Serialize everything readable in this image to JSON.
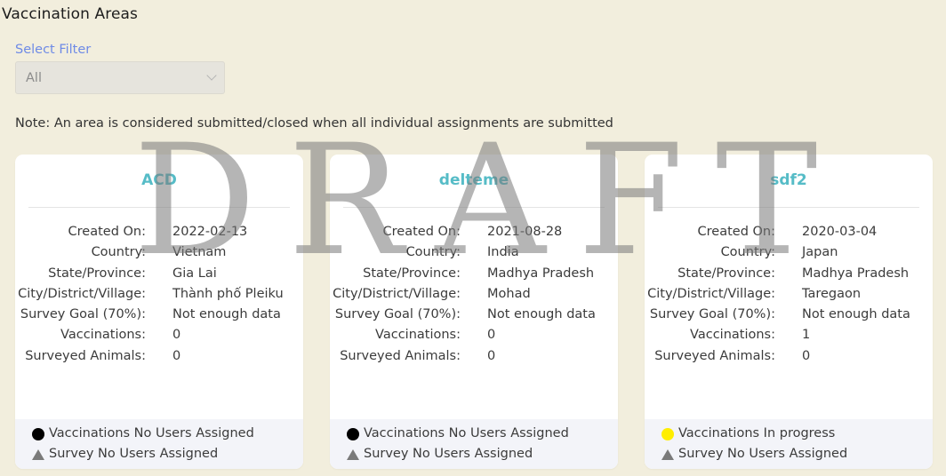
{
  "page": {
    "title": "Vaccination Areas",
    "filter_label": "Select Filter",
    "filter_value": "All",
    "note": "Note: An area is considered submitted/closed when all individual assignments are submitted",
    "watermark": "DRAFT"
  },
  "labels": {
    "created_on": "Created On:",
    "country": "Country:",
    "state": "State/Province:",
    "city": "City/District/Village:",
    "survey_goal": "Survey Goal (70%):",
    "vaccinations": "Vaccinations:",
    "surveyed": "Surveyed Animals:"
  },
  "colors": {
    "status_none": "#000000",
    "status_in_progress": "#ffee00",
    "survey_none": "#7a7a7a",
    "title_accent": "#56bcc7"
  },
  "cards": [
    {
      "name": "ACD",
      "created_on": "2022-02-13",
      "country": "Vietnam",
      "state": "Gia Lai",
      "city": "Thành phố Pleiku",
      "survey_goal": "Not enough data",
      "vaccinations": "0",
      "surveyed": "0",
      "vacc_status": "Vaccinations No Users Assigned",
      "vacc_icon": "black-circle-icon",
      "survey_status": "Survey No Users Assigned",
      "survey_icon": "gray-triangle-icon"
    },
    {
      "name": "delteme",
      "created_on": "2021-08-28",
      "country": "India",
      "state": "Madhya Pradesh",
      "city": "Mohad",
      "survey_goal": "Not enough data",
      "vaccinations": "0",
      "surveyed": "0",
      "vacc_status": "Vaccinations No Users Assigned",
      "vacc_icon": "black-circle-icon",
      "survey_status": "Survey No Users Assigned",
      "survey_icon": "gray-triangle-icon"
    },
    {
      "name": "sdf2",
      "created_on": "2020-03-04",
      "country": "Japan",
      "state": "Madhya Pradesh",
      "city": "Taregaon",
      "survey_goal": "Not enough data",
      "vaccinations": "1",
      "surveyed": "0",
      "vacc_status": "Vaccinations In progress",
      "vacc_icon": "yellow-circle-icon",
      "survey_status": "Survey No Users Assigned",
      "survey_icon": "gray-triangle-icon"
    }
  ]
}
